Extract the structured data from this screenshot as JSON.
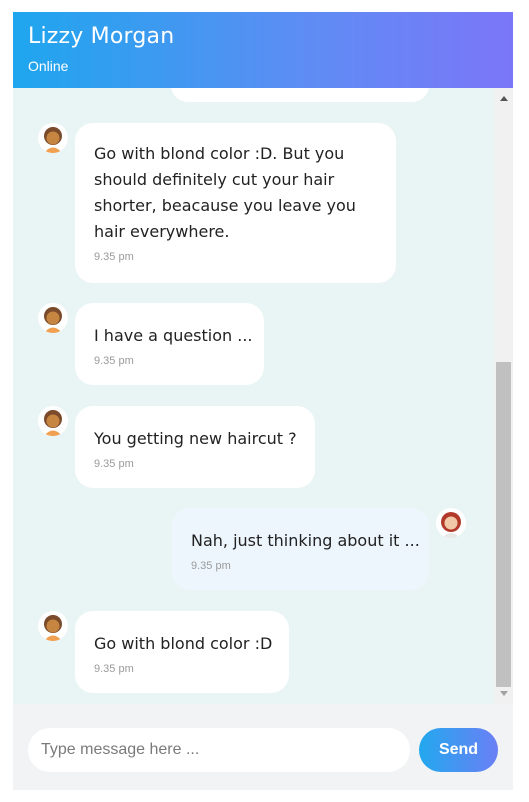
{
  "header": {
    "title": "Lizzy Morgan",
    "status": "Online"
  },
  "messages": [
    {
      "text": "Go with blond color :D. But you\nshould definitely cut your hair\nshorter, beacause you leave you\nhair everywhere.",
      "time": "9.35 pm",
      "direction": "incoming",
      "avatar": "brown-haired-woman-avatar"
    },
    {
      "text": "I have a question ...",
      "time": "9.35 pm",
      "direction": "incoming",
      "avatar": "brown-haired-woman-avatar"
    },
    {
      "text": "You getting new haircut ?",
      "time": "9.35 pm",
      "direction": "incoming",
      "avatar": "brown-haired-woman-avatar"
    },
    {
      "text": "Nah, just thinking about it ...",
      "time": "9.35 pm",
      "direction": "outgoing",
      "avatar": "red-haired-woman-avatar"
    },
    {
      "text": "Go with blond color :D",
      "time": "9.35 pm",
      "direction": "incoming",
      "avatar": "brown-haired-woman-avatar"
    }
  ],
  "composer": {
    "placeholder": "Type message here ...",
    "send_label": "Send"
  },
  "colors": {
    "header_start": "#1ea6ee",
    "header_end": "#7b76f8",
    "chat_bg": "#e9f4f4",
    "outgoing_bubble": "#eef6fd"
  }
}
